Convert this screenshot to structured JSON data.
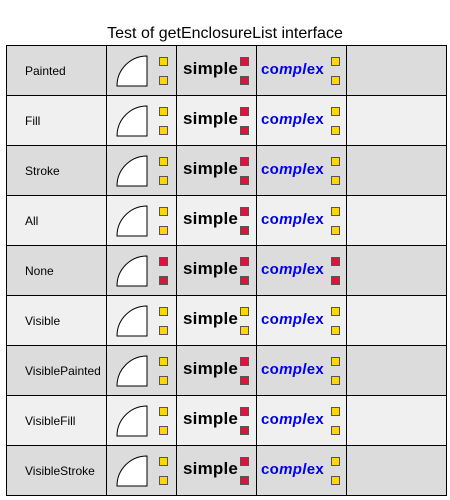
{
  "title": "Test of getEnclosureList interface",
  "colors": {
    "enclosed": "#ffd700",
    "not_enclosed": "#dc143c"
  },
  "text": {
    "simple": "simple",
    "complex_prefix": "co",
    "complex_mid": "mpl",
    "complex_suffix": "ex"
  },
  "rows": [
    {
      "label": "Painted",
      "shape": [
        "yellow",
        "yellow"
      ],
      "simple": [
        "red",
        "red"
      ],
      "complex": [
        "yellow",
        "yellow"
      ]
    },
    {
      "label": "Fill",
      "shape": [
        "yellow",
        "yellow"
      ],
      "simple": [
        "red",
        "red"
      ],
      "complex": [
        "yellow",
        "yellow"
      ]
    },
    {
      "label": "Stroke",
      "shape": [
        "yellow",
        "yellow"
      ],
      "simple": [
        "red",
        "red"
      ],
      "complex": [
        "yellow",
        "yellow"
      ]
    },
    {
      "label": "All",
      "shape": [
        "yellow",
        "yellow"
      ],
      "simple": [
        "red",
        "red"
      ],
      "complex": [
        "yellow",
        "yellow"
      ]
    },
    {
      "label": "None",
      "shape": [
        "red",
        "red"
      ],
      "simple": [
        "red",
        "red"
      ],
      "complex": [
        "red",
        "red"
      ]
    },
    {
      "label": "Visible",
      "shape": [
        "yellow",
        "yellow"
      ],
      "simple": [
        "yellow",
        "yellow"
      ],
      "complex": [
        "yellow",
        "yellow"
      ]
    },
    {
      "label": "VisiblePainted",
      "shape": [
        "yellow",
        "yellow"
      ],
      "simple": [
        "red",
        "red"
      ],
      "complex": [
        "yellow",
        "yellow"
      ]
    },
    {
      "label": "VisibleFill",
      "shape": [
        "yellow",
        "yellow"
      ],
      "simple": [
        "red",
        "red"
      ],
      "complex": [
        "yellow",
        "yellow"
      ]
    },
    {
      "label": "VisibleStroke",
      "shape": [
        "yellow",
        "yellow"
      ],
      "simple": [
        "red",
        "red"
      ],
      "complex": [
        "yellow",
        "yellow"
      ]
    }
  ]
}
